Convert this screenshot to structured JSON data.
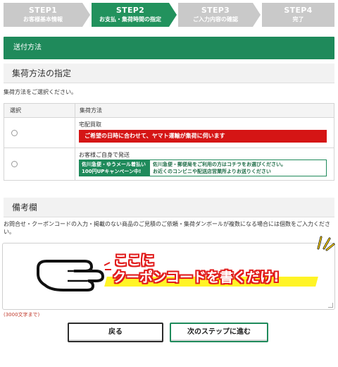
{
  "steps": [
    {
      "num": "STEP1",
      "label": "お客様基本情報",
      "active": false
    },
    {
      "num": "STEP2",
      "label": "お支払・集荷時間の指定",
      "active": true
    },
    {
      "num": "STEP3",
      "label": "ご入力内容の確認",
      "active": false
    },
    {
      "num": "STEP4",
      "label": "完了",
      "active": false
    }
  ],
  "section_title": "送付方法",
  "pickup": {
    "heading": "集荷方法の指定",
    "instruction": "集荷方法をご選択ください。",
    "col_select": "選択",
    "col_method": "集荷方法",
    "options": [
      {
        "name": "宅配買取",
        "notice": "ご希望の日時に合わせて、ヤマト運輸が集荷に伺います"
      },
      {
        "name": "お客様ご自身で発送",
        "badge_line1": "佐川急便・ゆうメール着払い",
        "badge_line2": "100円UPキャンペーン中!",
        "info_line1": "佐川急便・郵便局をご利用の方はコチラをお選びください。",
        "info_line2": "お近くのコンビニや配送店営業所よりお送りください"
      }
    ]
  },
  "remarks": {
    "heading": "備考欄",
    "instruction": "お問合せ・クーポンコードの入力・掲載のない商品のご見積のご依頼・集荷ダンボールが複数になる場合には個数をご入力ください。",
    "char_limit": "(3000文字まで)"
  },
  "overlay": {
    "line1": "ここに",
    "line2": "クーポンコードを書くだけ!"
  },
  "buttons": {
    "back": "戻る",
    "next": "次のステップに進む"
  },
  "colors": {
    "brand_green": "#1f8a5b",
    "accent_red": "#d51515",
    "step_inactive": "#c9c9c9"
  }
}
